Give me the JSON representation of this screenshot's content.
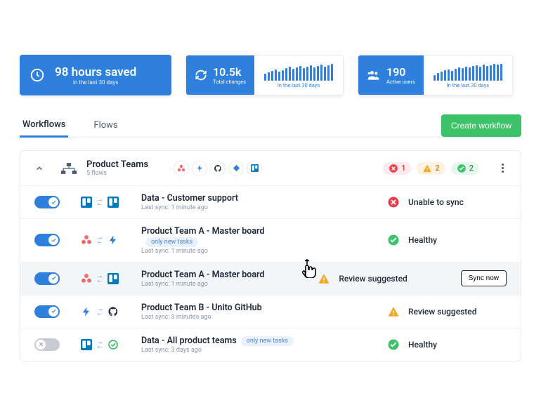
{
  "stats": {
    "hours": {
      "value": "98 hours saved",
      "sub": "in the last 30 days"
    },
    "changes": {
      "value": "10.5k",
      "label": "Total changes",
      "sub": "In the last 30 days"
    },
    "users": {
      "value": "190",
      "label": "Active users",
      "sub": "In the last 30 days"
    }
  },
  "tabs": {
    "workflows": "Workflows",
    "flows": "Flows"
  },
  "actions": {
    "create": "Create workflow",
    "sync_now": "Sync now"
  },
  "group": {
    "name": "Product Teams",
    "sub": "5 flows"
  },
  "badge_counts": {
    "error": "1",
    "warning": "2",
    "ok": "2"
  },
  "labels": {
    "only_new": "only new tasks"
  },
  "statuses": {
    "unable": "Unable to sync",
    "healthy": "Healthy",
    "review": "Review suggested"
  },
  "rows": [
    {
      "name": "Data - Customer support",
      "last": "Last sync: 1 minute ago"
    },
    {
      "name": "Product Team A - Master board",
      "last": "Last sync: 1 minute ago"
    },
    {
      "name": "Product Team A - Master board",
      "last": "Last sync: 1 minute ago"
    },
    {
      "name": "Product Team B - Unito GitHub",
      "last": "Last sync: 3 minutes ago"
    },
    {
      "name": "Data - All product teams",
      "last": "Last sync: 3 days ago"
    }
  ],
  "chart_data": {
    "type": "bar",
    "note": "sparkline bars, unlabeled – heights are relative estimates only",
    "changes_spark": [
      8,
      10,
      12,
      14,
      11,
      13,
      16,
      18,
      15,
      17,
      19,
      16,
      18,
      20,
      17,
      19,
      21,
      18,
      20,
      22
    ],
    "users_spark": [
      6,
      9,
      11,
      13,
      14,
      12,
      15,
      17,
      16,
      18,
      17,
      19,
      20,
      18,
      21,
      19,
      20,
      22,
      21,
      23
    ]
  }
}
